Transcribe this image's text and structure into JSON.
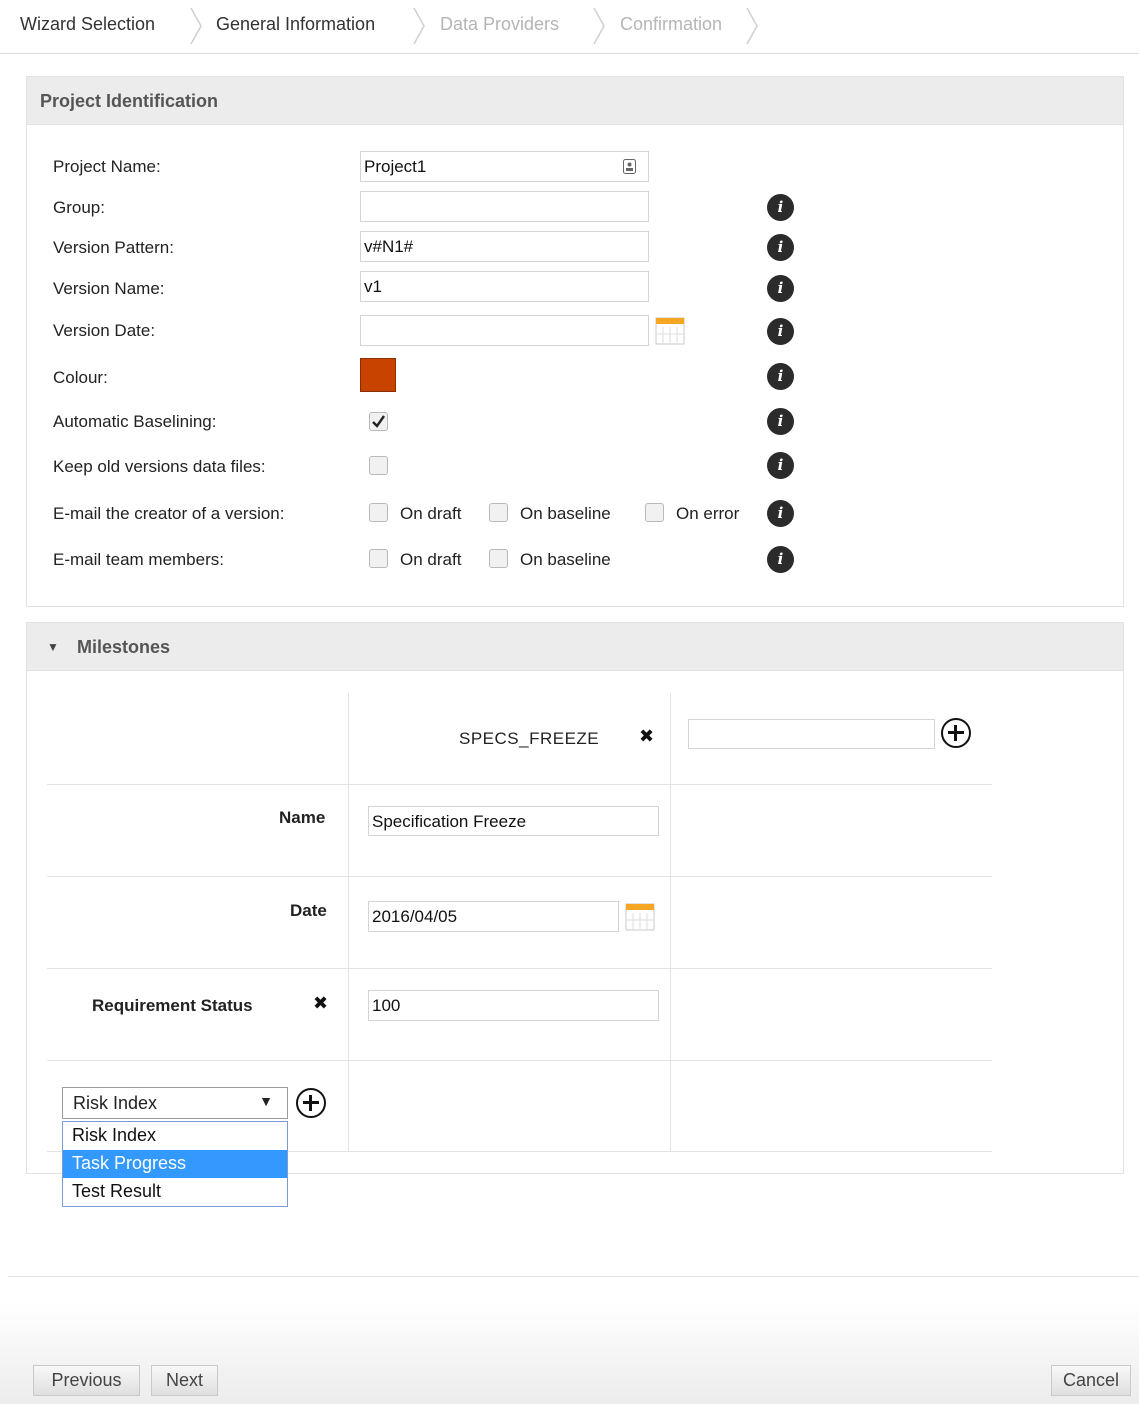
{
  "breadcrumb": [
    {
      "label": "Wizard Selection",
      "state": "done"
    },
    {
      "label": "General Information",
      "state": "current"
    },
    {
      "label": "Data Providers",
      "state": "pending"
    },
    {
      "label": "Confirmation",
      "state": "pending"
    }
  ],
  "project_identification": {
    "title": "Project Identification",
    "fields": {
      "project_name": {
        "label": "Project Name:",
        "value": "Project1"
      },
      "group": {
        "label": "Group:",
        "value": ""
      },
      "version_pattern": {
        "label": "Version Pattern:",
        "value": "v#N1#"
      },
      "version_name": {
        "label": "Version Name:",
        "value": "v1"
      },
      "version_date": {
        "label": "Version Date:",
        "value": ""
      },
      "colour": {
        "label": "Colour:",
        "value": "#c84300"
      },
      "automatic_baselining": {
        "label": "Automatic Baselining:",
        "checked": true
      },
      "keep_old_versions": {
        "label": "Keep old versions data files:",
        "checked": false
      },
      "email_creator": {
        "label": "E-mail the creator of a version:",
        "options": {
          "on_draft": "On draft",
          "on_baseline": "On baseline",
          "on_error": "On error"
        }
      },
      "email_team": {
        "label": "E-mail team members:",
        "options": {
          "on_draft": "On draft",
          "on_baseline": "On baseline"
        }
      }
    },
    "info_icon_glyph": "i"
  },
  "milestones": {
    "title": "Milestones",
    "milestone_code": "SPECS_FREEZE",
    "new_milestone_value": "",
    "rows": {
      "name": {
        "label": "Name",
        "value": "Specification Freeze"
      },
      "date": {
        "label": "Date",
        "value": "2016/04/05"
      },
      "requirement_status": {
        "label": "Requirement Status",
        "value": "100"
      }
    },
    "remove_glyph": "✖",
    "metric_select": {
      "selected": "Risk Index",
      "caret": "▼",
      "options": [
        "Risk Index",
        "Task Progress",
        "Test Result"
      ],
      "highlighted": "Task Progress"
    }
  },
  "footer": {
    "previous": "Previous",
    "next": "Next",
    "cancel": "Cancel"
  },
  "colors": {
    "accent_blue": "#3399ff",
    "colour_swatch": "#c84300",
    "calendar_orange": "#f5a623"
  }
}
